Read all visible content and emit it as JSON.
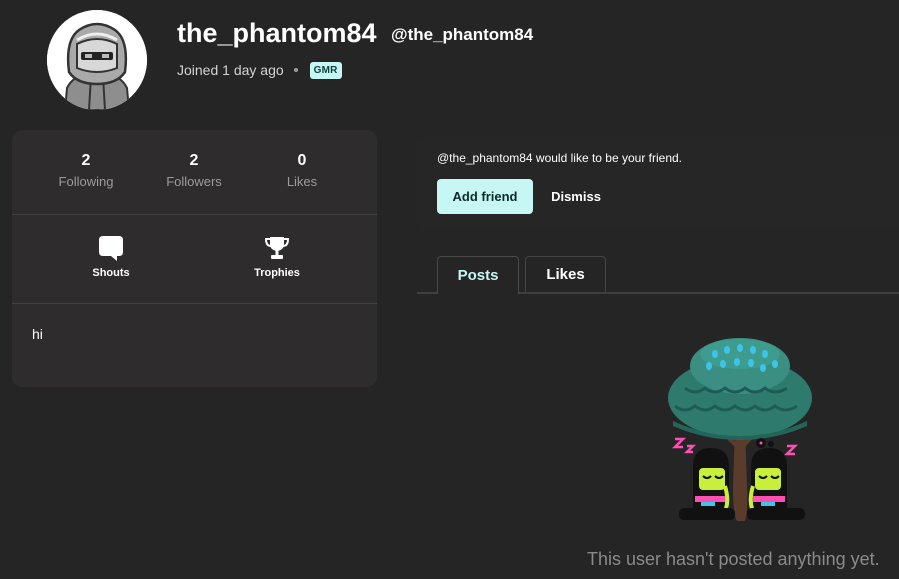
{
  "profile": {
    "display_name": "the_phantom84",
    "handle": "@the_phantom84",
    "joined": "Joined 1 day ago",
    "badge": "GMR",
    "bio": "hi"
  },
  "stats": [
    {
      "value": "2",
      "label": "Following"
    },
    {
      "value": "2",
      "label": "Followers"
    },
    {
      "value": "0",
      "label": "Likes"
    }
  ],
  "actions": [
    {
      "label": "Shouts",
      "icon": "speech-bubble-icon"
    },
    {
      "label": "Trophies",
      "icon": "trophy-icon"
    }
  ],
  "friend_request": {
    "message": "@the_phantom84 would like to be your friend.",
    "add_label": "Add friend",
    "dismiss_label": "Dismiss"
  },
  "tabs": [
    {
      "label": "Posts",
      "active": true
    },
    {
      "label": "Likes",
      "active": false
    }
  ],
  "empty_state": {
    "message": "This user hasn't posted anything yet.",
    "illustration": "sleeping-under-tree-illustration"
  },
  "colors": {
    "background": "#252525",
    "card": "#2e2c2c",
    "accent": "#c6f7f5",
    "muted_text": "#9b9b9b"
  }
}
